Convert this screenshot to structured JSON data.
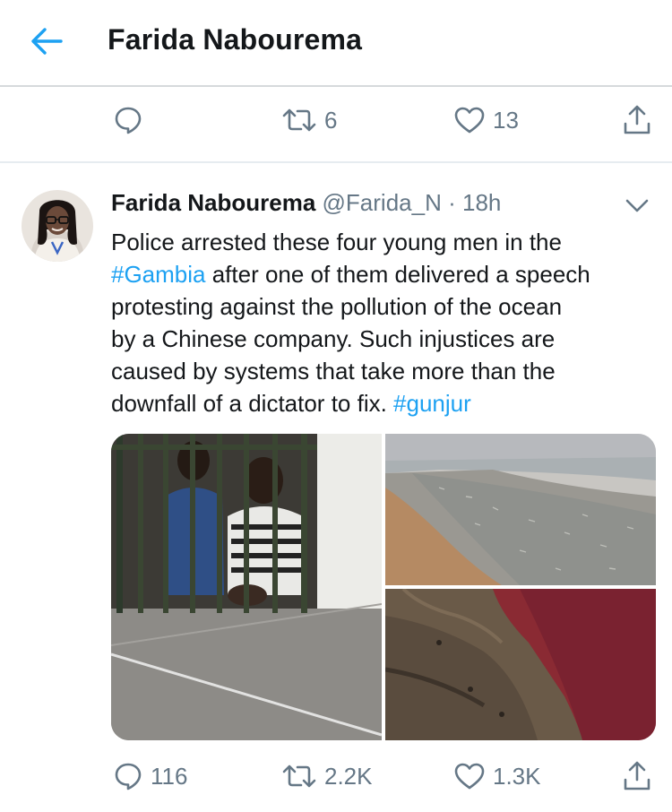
{
  "header": {
    "title": "Farida Nabourema",
    "back_icon": "arrow-left-icon",
    "accent": "#1da1f2"
  },
  "top_actions": {
    "retweets": "6",
    "likes": "13"
  },
  "tweet": {
    "author_name": "Farida Nabourema",
    "handle": "@Farida_N",
    "separator": "·",
    "time": "18h",
    "text": {
      "l1": "Police arrested these four young men in the",
      "l2_tag": "#Gambia",
      "l2_rest": " after one of them delivered a speech",
      "l3": "protesting against the pollution of the ocean",
      "l4": "by a Chinese company. Such injustices are",
      "l5": "caused by systems that take more than the",
      "l6_pre": "downfall of a dictator to fix. ",
      "l6_tag": "#gunjur"
    },
    "media": [
      "photo-men-behind-bars",
      "photo-fish-on-beach",
      "photo-red-polluted-water"
    ],
    "actions": {
      "replies": "116",
      "retweets": "2.2K",
      "likes": "1.3K"
    }
  },
  "colors": {
    "icon_gray": "#657786",
    "link_blue": "#1da1f2",
    "text": "#14171a"
  }
}
